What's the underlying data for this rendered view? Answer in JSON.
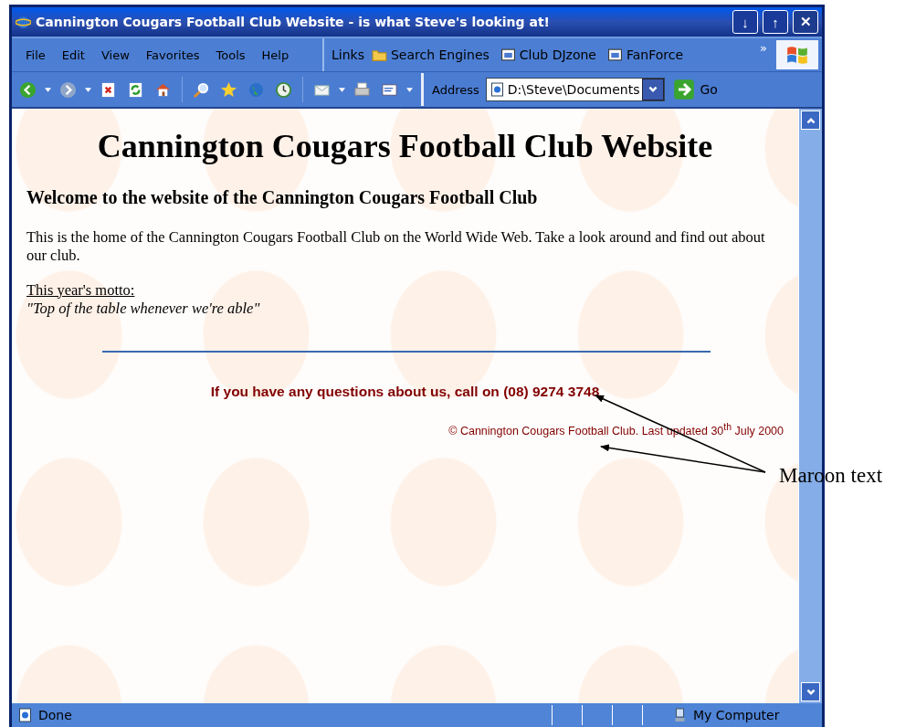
{
  "window": {
    "title": "Cannington Cougars Football Club Website - is what Steve's looking at!",
    "controls": [
      {
        "label": "↓"
      },
      {
        "label": "↑"
      },
      {
        "label": "✕",
        "kind": "close"
      }
    ]
  },
  "menu": [
    "File",
    "Edit",
    "View",
    "Favorites",
    "Tools",
    "Help"
  ],
  "links": {
    "label": "Links",
    "items": [
      {
        "label": "Search Engines",
        "kind": "folder"
      },
      {
        "label": "Club DJzone",
        "kind": "page"
      },
      {
        "label": "FanForce",
        "kind": "page"
      }
    ],
    "more": "»"
  },
  "address": {
    "label": "Address",
    "value": "D:\\Steve\\Documents",
    "go": "Go"
  },
  "page": {
    "heading": "Cannington Cougars Football Club Website",
    "subheading": "Welcome to the website of the Cannington Cougars Football Club",
    "intro": "This is the home of the Cannington Cougars Football Club on the World Wide Web. Take a look around and find out about our club.",
    "motto_label": "This year's motto:",
    "motto": "\"Top of the table whenever we're able\"",
    "contact": "If you have any questions about us, call on (08) 9274 3748",
    "footer": "© Cannington Cougars Football Club. Last updated 30$^{th}$ July 2000"
  },
  "status_bar": {
    "text": "Done",
    "zone": "My Computer"
  },
  "annotation": {
    "label": "Maroon text"
  }
}
